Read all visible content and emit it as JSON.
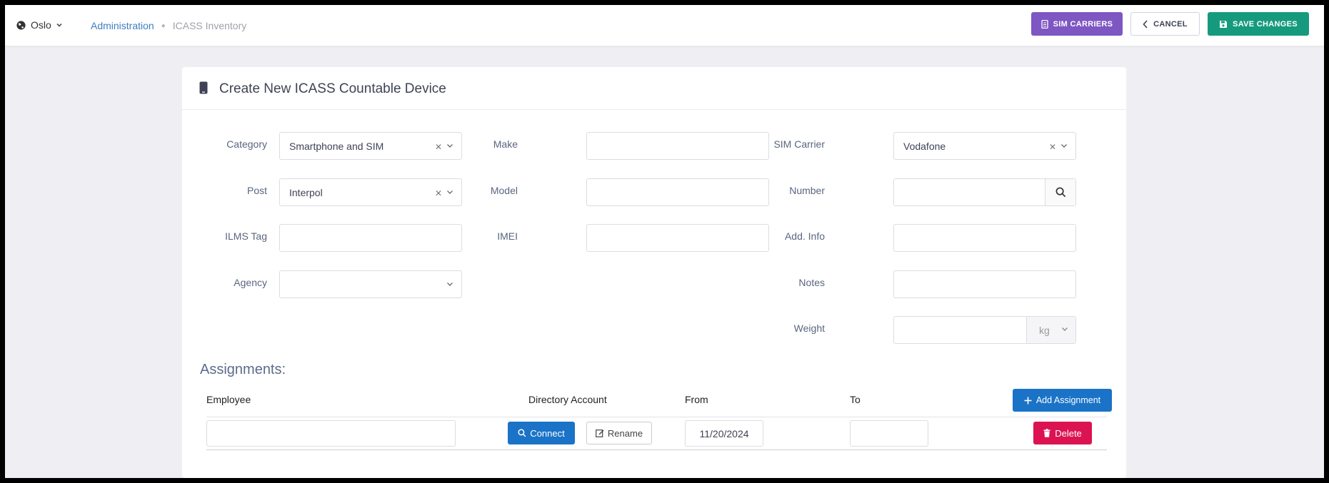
{
  "topbar": {
    "location": "Oslo",
    "breadcrumb": [
      "Administration",
      "ICASS Inventory"
    ],
    "sim_carriers_label": "SIM CARRIERS",
    "cancel_label": "CANCEL",
    "save_label": "SAVE CHANGES"
  },
  "card": {
    "title": "Create New ICASS Countable Device"
  },
  "form": {
    "category": {
      "label": "Category",
      "value": "Smartphone and SIM"
    },
    "post": {
      "label": "Post",
      "value": "Interpol"
    },
    "ilms_tag": {
      "label": "ILMS Tag",
      "value": ""
    },
    "agency": {
      "label": "Agency",
      "value": ""
    },
    "make": {
      "label": "Make",
      "value": ""
    },
    "model": {
      "label": "Model",
      "value": ""
    },
    "imei": {
      "label": "IMEI",
      "value": ""
    },
    "sim_carrier": {
      "label": "SIM Carrier",
      "value": "Vodafone"
    },
    "number": {
      "label": "Number",
      "value": ""
    },
    "add_info": {
      "label": "Add. Info",
      "value": ""
    },
    "notes": {
      "label": "Notes",
      "value": ""
    },
    "weight": {
      "label": "Weight",
      "value": "",
      "unit": "kg"
    }
  },
  "assignments": {
    "title": "Assignments:",
    "columns": [
      "Employee",
      "Directory Account",
      "From",
      "To"
    ],
    "add_label": "Add Assignment",
    "rows": [
      {
        "employee": "",
        "connect_label": "Connect",
        "rename_label": "Rename",
        "from": "11/20/2024",
        "to": "",
        "delete_label": "Delete"
      }
    ]
  },
  "colors": {
    "sim_carriers_btn": "#7e57c2",
    "save_btn": "#169a7e",
    "primary_btn": "#1a73c7",
    "delete_btn": "#dc1352"
  }
}
